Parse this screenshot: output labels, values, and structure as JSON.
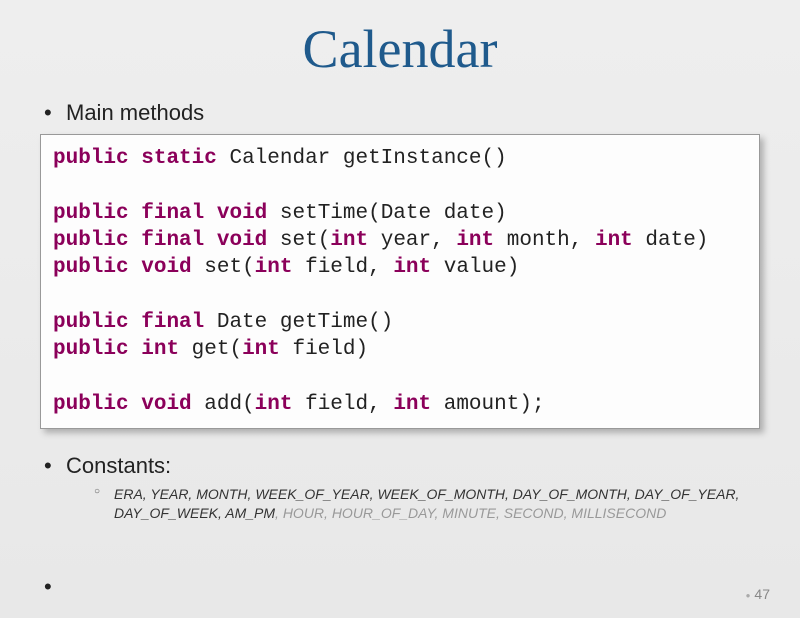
{
  "title": "Calendar",
  "section1": "Main methods",
  "section2": "Constants:",
  "code": {
    "l1": {
      "kw1": "public",
      "kw2": "static",
      "t": " Calendar getInstance()"
    },
    "l2": {
      "kw1": "public",
      "kw2": "final",
      "kw3": "void",
      "t": " setTime(Date date)"
    },
    "l3": {
      "kw1": "public",
      "kw2": "final",
      "kw3": "void",
      "t1": " set(",
      "kw4": "int",
      "t2": " year, ",
      "kw5": "int",
      "t3": " month, ",
      "kw6": "int",
      "t4": " date)"
    },
    "l4": {
      "kw1": "public",
      "kw2": "void",
      "t1": " set(",
      "kw3": "int",
      "t2": " field, ",
      "kw4": "int",
      "t3": " value)"
    },
    "l5": {
      "kw1": "public",
      "kw2": "final",
      "t": " Date getTime()"
    },
    "l6": {
      "kw1": "public",
      "kw2": "int",
      "t1": " get(",
      "kw3": "int",
      "t2": " field)"
    },
    "l7": {
      "kw1": "public",
      "kw2": "void",
      "t1": " add(",
      "kw3": "int",
      "t2": " field, ",
      "kw4": "int",
      "t3": " amount);"
    }
  },
  "constants": {
    "dark": "ERA, YEAR, MONTH, WEEK_OF_YEAR, WEEK_OF_MONTH, DAY_OF_MONTH, DAY_OF_YEAR, DAY_OF_WEEK, AM_PM",
    "light": ", HOUR, HOUR_OF_DAY, MINUTE, SECOND, MILLISECOND"
  },
  "slideNumber": "47"
}
